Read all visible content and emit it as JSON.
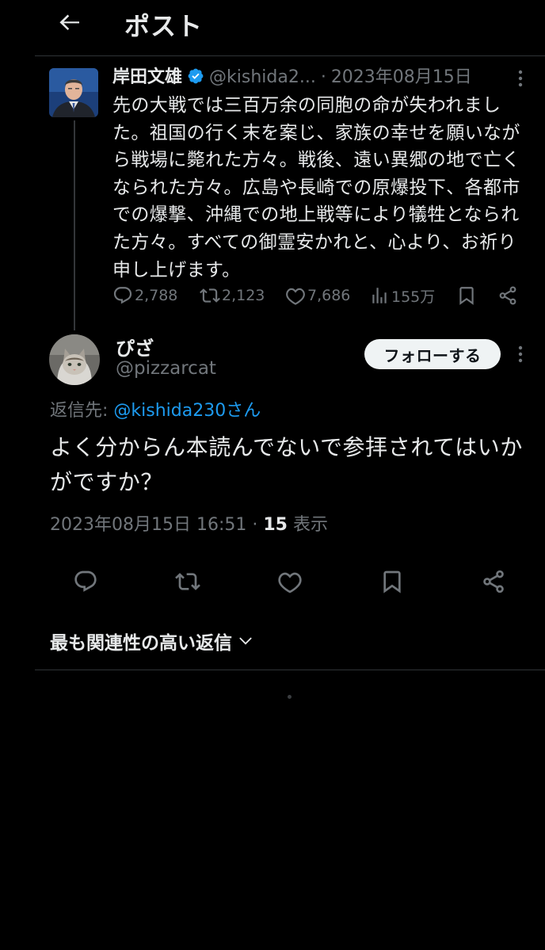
{
  "header": {
    "title": "ポスト"
  },
  "original_tweet": {
    "author_name": "岸田文雄",
    "handle": "@kishida2...",
    "separator": "·",
    "date": "2023年08月15日",
    "body": "先の大戦では三百万余の同胞の命が失われました。祖国の行く末を案じ、家族の幸せを願いながら戦場に斃れた方々。戦後、遠い異郷の地で亡くなられた方々。広島や長崎での原爆投下、各都市での爆撃、沖縄での地上戦等により犠牲となられた方々。すべての御霊安かれと、心より、お祈り申し上げます。",
    "replies": "2,788",
    "reposts": "2,123",
    "likes": "7,686",
    "views": "155万",
    "colors": {
      "verified": "#1d9bf0"
    }
  },
  "reply_tweet": {
    "author_name": "ぴざ",
    "handle": "@pizzarcat",
    "follow_label": "フォローする",
    "reply_to_label": "返信先:",
    "reply_to_link": "@kishida230さん",
    "body": "よく分からん本読んでないで参拝されてはいかがですか？",
    "timestamp": "2023年08月15日 16:51",
    "separator": "·",
    "view_count": "15",
    "view_label": "表示"
  },
  "replies_sort": {
    "label": "最も関連性の高い返信"
  },
  "icons": {
    "back": "arrow-left-icon",
    "verified": "verified-badge-icon",
    "more": "more-vertical-icon",
    "reply": "speech-bubble-icon",
    "repost": "repost-icon",
    "like": "heart-icon",
    "views": "bar-chart-icon",
    "bookmark": "bookmark-icon",
    "share": "share-icon",
    "chevron": "chevron-down-icon"
  },
  "colors": {
    "background": "#000000",
    "text": "#e7e9ea",
    "muted": "#71767b",
    "link": "#1d9bf0",
    "border": "#2f3336"
  }
}
